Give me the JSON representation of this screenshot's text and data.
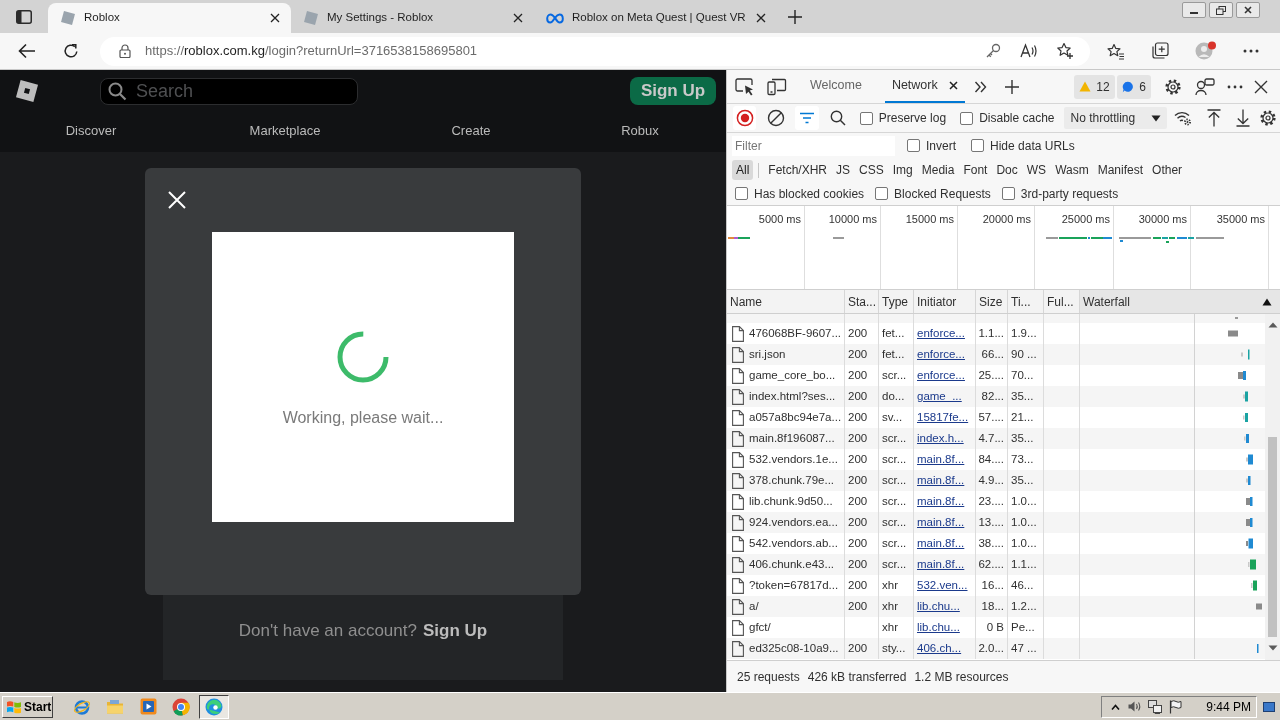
{
  "browser": {
    "tabs": [
      {
        "title": "Roblox",
        "kind": "tile",
        "selected": true
      },
      {
        "title": "My Settings - Roblox",
        "kind": "tile",
        "selected": false
      },
      {
        "title": "Roblox on Meta Quest | Quest VR",
        "kind": "infinity",
        "selected": false
      }
    ],
    "address": {
      "scheme": "https://",
      "host": "roblox.com.kg",
      "path": "/login?returnUrl=3716538158695801"
    }
  },
  "page": {
    "search": {
      "placeholder": "Search"
    },
    "signup_button": "Sign Up",
    "nav": [
      "Discover",
      "Marketplace",
      "Create",
      "Robux"
    ],
    "modal": {
      "message": "Working, please wait..."
    },
    "signup_prompt": {
      "text": "Don't have an account?",
      "link": "Sign Up"
    }
  },
  "devtools": {
    "tabs": [
      {
        "label": "Welcome",
        "selected": false
      },
      {
        "label": "Network",
        "selected": true
      }
    ],
    "warnings": "12",
    "messages": "6",
    "toolbar": {
      "recording": true,
      "filters_on": true,
      "checkboxes": [
        {
          "label": "Preserve log",
          "checked": false
        },
        {
          "label": "Disable cache",
          "checked": false
        }
      ],
      "throttling": "No throttling"
    },
    "filter": {
      "placeholder": "Filter",
      "checkboxes": [
        {
          "label": "Invert",
          "checked": false
        },
        {
          "label": "Hide data URLs",
          "checked": false
        }
      ]
    },
    "type_filters": [
      {
        "label": "All",
        "selected": true
      },
      {
        "label": "Fetch/XHR",
        "selected": false
      },
      {
        "label": "JS",
        "selected": false
      },
      {
        "label": "CSS",
        "selected": false
      },
      {
        "label": "Img",
        "selected": false
      },
      {
        "label": "Media",
        "selected": false
      },
      {
        "label": "Font",
        "selected": false
      },
      {
        "label": "Doc",
        "selected": false
      },
      {
        "label": "WS",
        "selected": false
      },
      {
        "label": "Wasm",
        "selected": false
      },
      {
        "label": "Manifest",
        "selected": false
      },
      {
        "label": "Other",
        "selected": false
      }
    ],
    "options": [
      {
        "label": "Has blocked cookies",
        "checked": false
      },
      {
        "label": "Blocked Requests",
        "checked": false
      },
      {
        "label": "3rd-party requests",
        "checked": false
      }
    ],
    "overview": {
      "ticks": [
        "5000 ms",
        "10000 ms",
        "15000 ms",
        "20000 ms",
        "25000 ms",
        "30000 ms",
        "35000 ms"
      ]
    },
    "table": {
      "columns": [
        "Name",
        "Sta...",
        "Type",
        "Initiator",
        "Size",
        "Ti...",
        "Ful...",
        "Waterfall"
      ],
      "rows": [
        {
          "name": "476068BF-9607...",
          "status": "200",
          "type": "fet...",
          "initiator": "enforce...",
          "size": "1.1...",
          "time": "1.9..."
        },
        {
          "name": "sri.json",
          "status": "200",
          "type": "fet...",
          "initiator": "enforce...",
          "size": "66...",
          "time": "90 ..."
        },
        {
          "name": "game_core_bo...",
          "status": "200",
          "type": "scr...",
          "initiator": "enforce...",
          "size": "25....",
          "time": "70..."
        },
        {
          "name": "index.html?ses...",
          "status": "200",
          "type": "do...",
          "initiator": "game_...",
          "size": "82...",
          "time": "35..."
        },
        {
          "name": "a057a8bc94e7a...",
          "status": "200",
          "type": "sv...",
          "initiator": "15817fe...",
          "size": "57....",
          "time": "21..."
        },
        {
          "name": "main.8f196087...",
          "status": "200",
          "type": "scr...",
          "initiator": "index.h...",
          "size": "4.7...",
          "time": "35..."
        },
        {
          "name": "532.vendors.1e...",
          "status": "200",
          "type": "scr...",
          "initiator": "main.8f...",
          "size": "84....",
          "time": "73..."
        },
        {
          "name": "378.chunk.79e...",
          "status": "200",
          "type": "scr...",
          "initiator": "main.8f...",
          "size": "4.9...",
          "time": "35..."
        },
        {
          "name": "lib.chunk.9d50...",
          "status": "200",
          "type": "scr...",
          "initiator": "main.8f...",
          "size": "23....",
          "time": "1.0..."
        },
        {
          "name": "924.vendors.ea...",
          "status": "200",
          "type": "scr...",
          "initiator": "main.8f...",
          "size": "13....",
          "time": "1.0..."
        },
        {
          "name": "542.vendors.ab...",
          "status": "200",
          "type": "scr...",
          "initiator": "main.8f...",
          "size": "38....",
          "time": "1.0..."
        },
        {
          "name": "406.chunk.e43...",
          "status": "200",
          "type": "scr...",
          "initiator": "main.8f...",
          "size": "62....",
          "time": "1.1..."
        },
        {
          "name": "?token=67817d...",
          "status": "200",
          "type": "xhr",
          "initiator": "532.ven...",
          "size": "16...",
          "time": "46..."
        },
        {
          "name": "a/",
          "status": "200",
          "type": "xhr",
          "initiator": "lib.chu...",
          "size": "18...",
          "time": "1.2..."
        },
        {
          "name": "gfct/",
          "type": "xhr",
          "initiator": "lib.chu...",
          "size": "0 B",
          "time": "Pe..."
        },
        {
          "name": "ed325c08-10a9...",
          "status": "200",
          "type": "sty...",
          "initiator": "406.ch...",
          "size": "2.0...",
          "time": "47 ..."
        }
      ]
    },
    "summary": [
      "25 requests",
      "426 kB transferred",
      "1.2 MB resources"
    ]
  },
  "taskbar": {
    "start": "Start",
    "clock": "9:44 PM"
  }
}
